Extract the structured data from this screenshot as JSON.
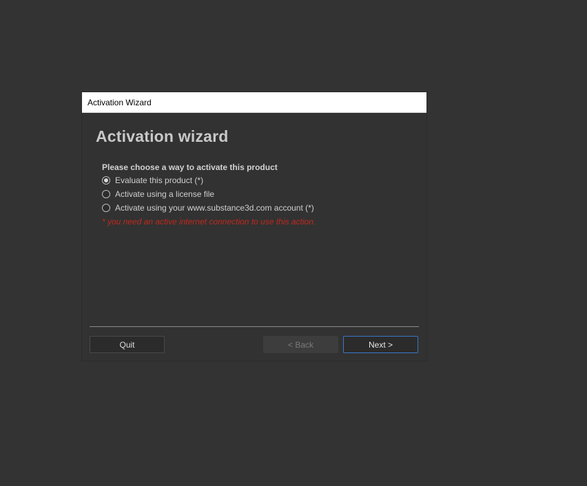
{
  "window": {
    "title": "Activation Wizard"
  },
  "wizard": {
    "heading": "Activation wizard",
    "prompt": "Please choose a way to activate this product",
    "options": [
      {
        "label": "Evaluate this product (*)",
        "selected": true
      },
      {
        "label": "Activate using a license file",
        "selected": false
      },
      {
        "label": "Activate using your www.substance3d.com account (*)",
        "selected": false
      }
    ],
    "note": "* you need an active internet connection to use this action."
  },
  "buttons": {
    "quit": "Quit",
    "back": "< Back",
    "next": "Next >"
  },
  "colors": {
    "background": "#333333",
    "note_red": "#c0281e",
    "focus_blue": "#3a78c9"
  }
}
